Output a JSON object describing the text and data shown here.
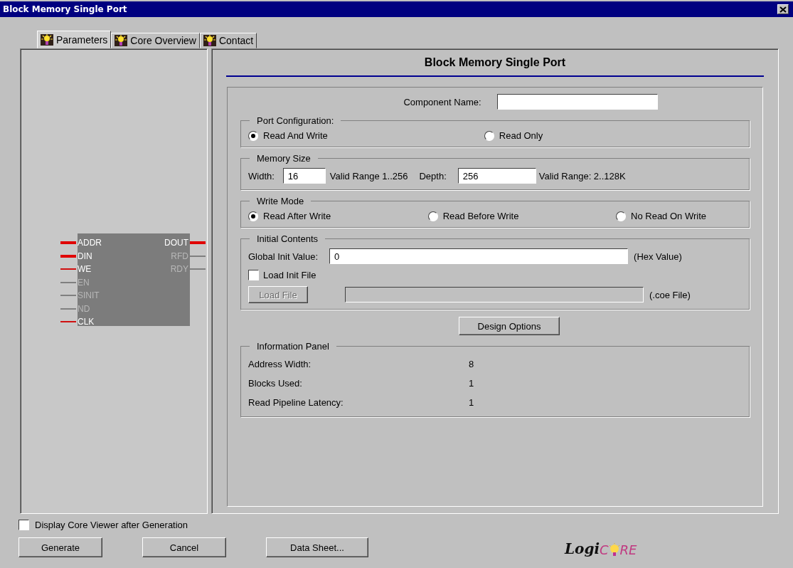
{
  "window": {
    "title": "Block Memory Single Port"
  },
  "tabs": [
    {
      "label": "Parameters",
      "selected": true
    },
    {
      "label": "Core Overview",
      "selected": false
    },
    {
      "label": "Contact",
      "selected": false
    }
  ],
  "symbol": {
    "left_pins": [
      {
        "name": "ADDR",
        "kind": "bus"
      },
      {
        "name": "DIN",
        "kind": "bus"
      },
      {
        "name": "WE",
        "kind": "used"
      },
      {
        "name": "EN",
        "kind": "unused"
      },
      {
        "name": "SINIT",
        "kind": "unused"
      },
      {
        "name": "ND",
        "kind": "unused"
      },
      {
        "name": "CLK",
        "kind": "used"
      }
    ],
    "right_pins": [
      {
        "name": "DOUT",
        "kind": "bus"
      },
      {
        "name": "RFD",
        "kind": "unused"
      },
      {
        "name": "RDY",
        "kind": "unused"
      }
    ]
  },
  "form": {
    "heading": "Block Memory Single Port",
    "component_name": {
      "label": "Component Name:"
    },
    "port_configuration": {
      "title": "Port Configuration:",
      "options": [
        {
          "label": "Read And Write",
          "selected": true
        },
        {
          "label": "Read Only",
          "selected": false
        }
      ]
    },
    "memory_size": {
      "title": "Memory Size",
      "width_label": "Width:",
      "width_value": "16",
      "width_range": "Valid Range 1..256",
      "depth_label": "Depth:",
      "depth_value": "256",
      "depth_range": "Valid Range: 2..128K"
    },
    "write_mode": {
      "title": "Write Mode",
      "options": [
        {
          "label": "Read After Write",
          "selected": true
        },
        {
          "label": "Read Before Write",
          "selected": false
        },
        {
          "label": "No Read On Write",
          "selected": false
        }
      ]
    },
    "initial_contents": {
      "title": "Initial Contents",
      "global_init_label": "Global Init Value:",
      "global_init_value": "0",
      "hex_note": "(Hex Value)",
      "load_init_file": {
        "label": "Load Init File",
        "checked": false
      },
      "load_file_button": {
        "label": "Load File",
        "disabled": true
      },
      "coe_note": "(.coe File)"
    },
    "design_options_button": "Design Options",
    "information_panel": {
      "title": "Information Panel",
      "rows": [
        {
          "label": "Address Width:",
          "value": "8"
        },
        {
          "label": "Blocks Used:",
          "value": "1"
        },
        {
          "label": "Read Pipeline Latency:",
          "value": "1"
        }
      ]
    }
  },
  "display_core_viewer": {
    "label": "Display Core Viewer after Generation",
    "checked": false
  },
  "buttons": [
    "Generate",
    "Cancel",
    "Data Sheet..."
  ],
  "logo": {
    "parts": [
      "Logi",
      "C",
      "RE"
    ]
  }
}
